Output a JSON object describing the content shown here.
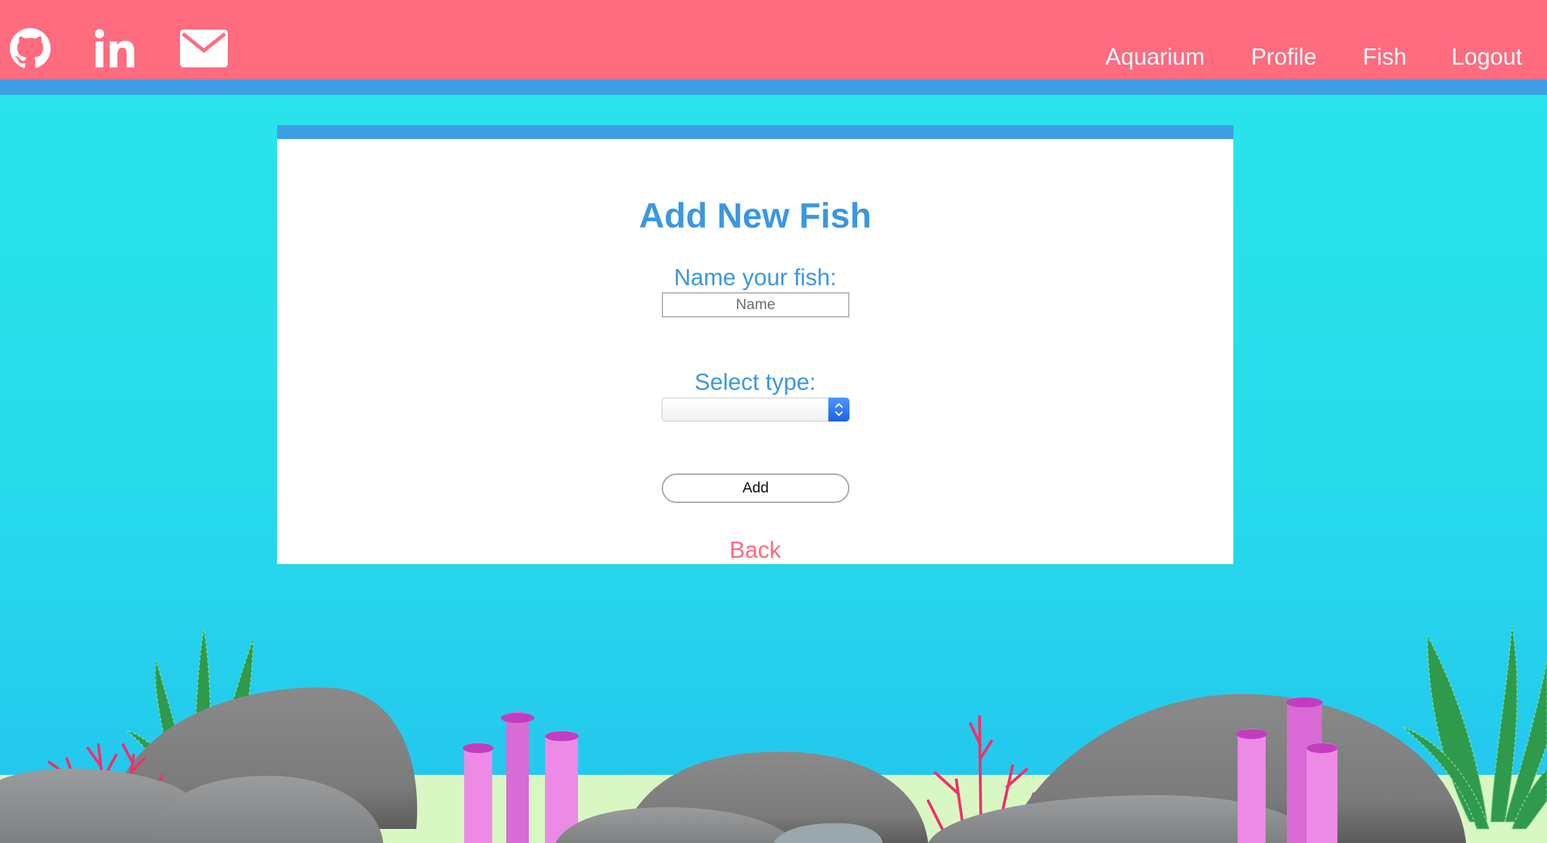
{
  "header": {
    "social": [
      {
        "name": "github-icon"
      },
      {
        "name": "linkedin-icon"
      },
      {
        "name": "email-icon"
      }
    ],
    "nav": [
      "Aquarium",
      "Profile",
      "Fish",
      "Logout"
    ]
  },
  "form": {
    "title": "Add New Fish",
    "name_label": "Name your fish:",
    "name_placeholder": "Name",
    "name_value": "",
    "type_label": "Select type:",
    "type_selected": "",
    "add_label": "Add",
    "back_label": "Back"
  },
  "colors": {
    "header": "#ff6b7f",
    "accent_blue": "#3f9ee3",
    "water": "#29e6ea",
    "sand": "#d8f7c2",
    "back_link": "#ff6b7f"
  }
}
